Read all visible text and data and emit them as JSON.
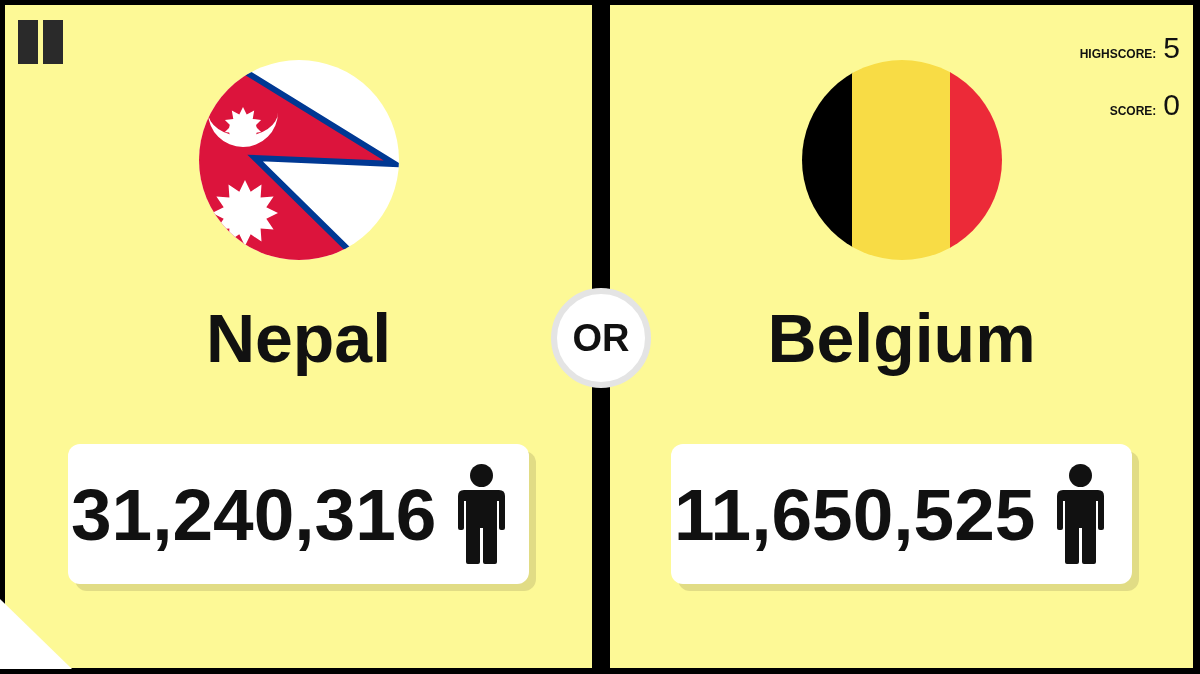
{
  "countries": [
    {
      "kind": "nepal",
      "name": "Nepal",
      "population": "31,240,316"
    },
    {
      "kind": "belgium",
      "name": "Belgium",
      "population": "11,650,525"
    }
  ],
  "divider": {
    "label": "OR"
  },
  "scoreboard": {
    "highscore_label": "HIGHSCORE:",
    "highscore": "5",
    "score_label": "SCORE:",
    "score": "0"
  }
}
